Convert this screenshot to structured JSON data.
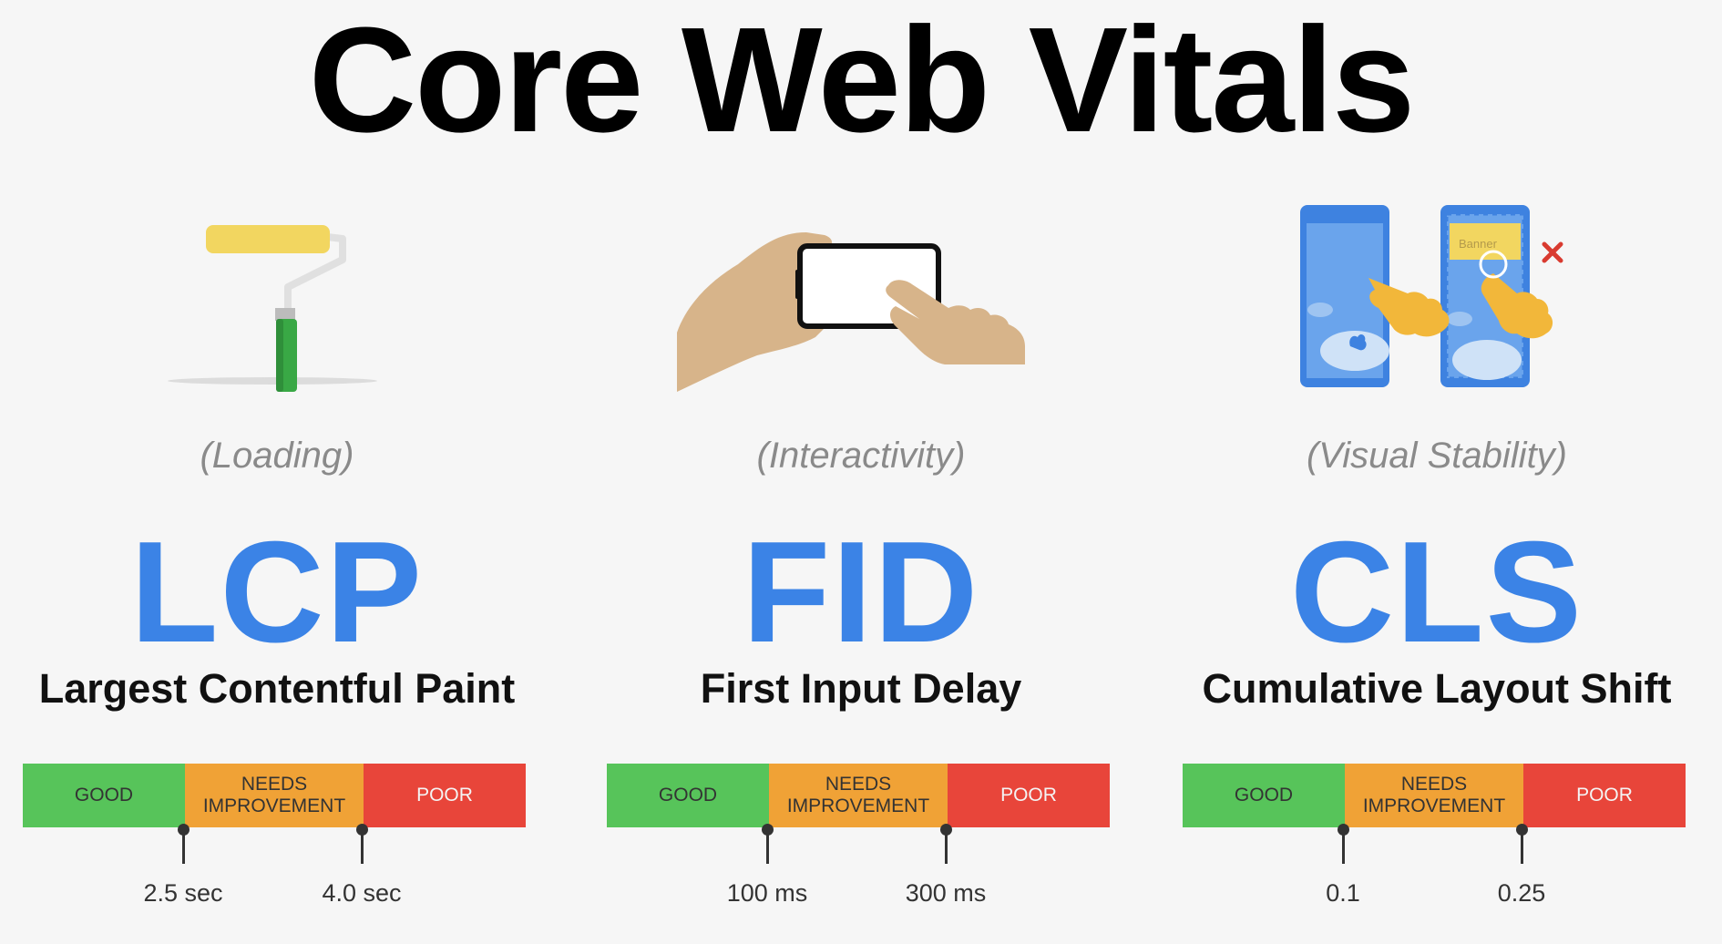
{
  "title": "Core Web Vitals",
  "colors": {
    "metric_blue": "#3b83e6",
    "good": "#57c45a",
    "needs_improvement": "#f0a236",
    "poor": "#e8453a"
  },
  "metrics": [
    {
      "icon": "paint-roller-icon",
      "category": "(Loading)",
      "abbr": "LCP",
      "name": "Largest Contentful Paint",
      "segments": {
        "good": "GOOD",
        "needs_line1": "NEEDS",
        "needs_line2": "IMPROVEMENT",
        "poor": "POOR"
      },
      "thresholds": [
        "2.5 sec",
        "4.0 sec"
      ]
    },
    {
      "icon": "phone-tap-icon",
      "category": "(Interactivity)",
      "abbr": "FID",
      "name": "First Input Delay",
      "segments": {
        "good": "GOOD",
        "needs_line1": "NEEDS",
        "needs_line2": "IMPROVEMENT",
        "poor": "POOR"
      },
      "thresholds": [
        "100 ms",
        "300 ms"
      ]
    },
    {
      "icon": "layout-shift-icon",
      "category": "(Visual Stability)",
      "abbr": "CLS",
      "name": "Cumulative Layout Shift",
      "segments": {
        "good": "GOOD",
        "needs_line1": "NEEDS",
        "needs_line2": "IMPROVEMENT",
        "poor": "POOR"
      },
      "thresholds": [
        "0.1",
        "0.25"
      ],
      "banner_text": "Banner"
    }
  ]
}
